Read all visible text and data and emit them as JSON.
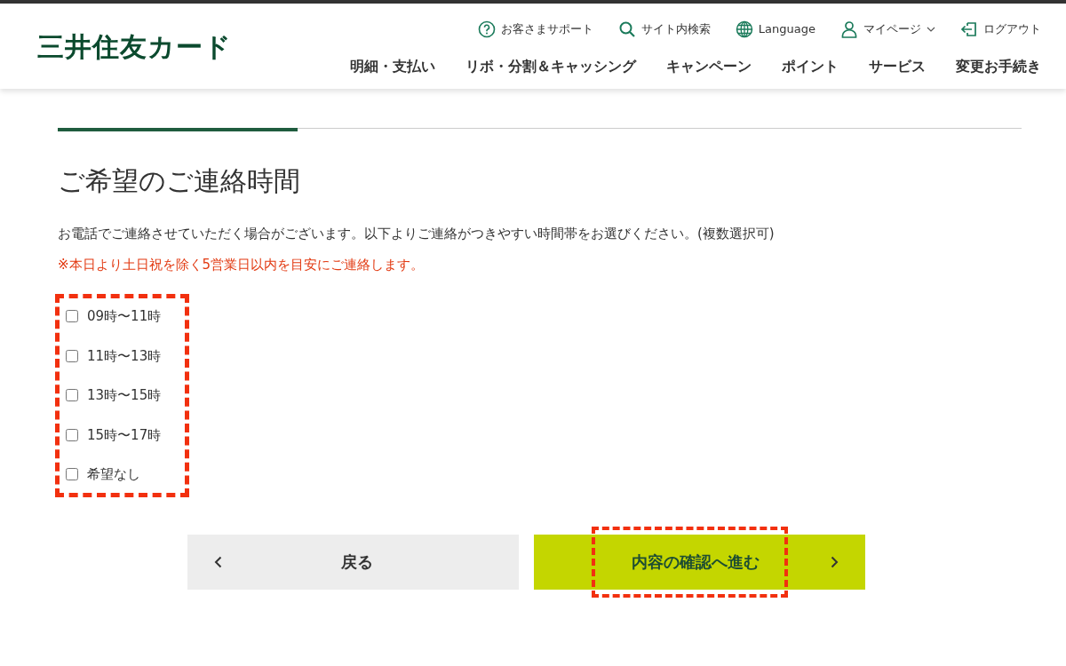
{
  "header": {
    "logo": "三井住友カード",
    "utility_links": [
      {
        "kind": "support",
        "label": "お客さまサポート"
      },
      {
        "kind": "search",
        "label": "サイト内検索"
      },
      {
        "kind": "language",
        "label": "Language"
      },
      {
        "kind": "mypage",
        "label": "マイページ",
        "dropdown": true
      },
      {
        "kind": "logout",
        "label": "ログアウト"
      }
    ],
    "nav": [
      "明細・支払い",
      "リボ・分割＆キャッシング",
      "キャンペーン",
      "ポイント",
      "サービス",
      "変更お手続き"
    ]
  },
  "section": {
    "title": "ご希望のご連絡時間",
    "description": "お電話でご連絡させていただく場合がございます。以下よりご連絡がつきやすい時間帯をお選びください。(複数選択可)",
    "note": "※本日より土日祝を除く5営業日以内を目安にご連絡します。",
    "options_highlighted": true,
    "options": [
      {
        "label": "09時〜11時",
        "checked": false
      },
      {
        "label": "11時〜13時",
        "checked": false
      },
      {
        "label": "13時〜15時",
        "checked": false
      },
      {
        "label": "15時〜17時",
        "checked": false
      },
      {
        "label": "希望なし",
        "checked": false
      }
    ]
  },
  "buttons": [
    {
      "kind": "back",
      "label": "戻る",
      "highlighted": false
    },
    {
      "kind": "next",
      "label": "内容の確認へ進む",
      "highlighted": true
    }
  ]
}
